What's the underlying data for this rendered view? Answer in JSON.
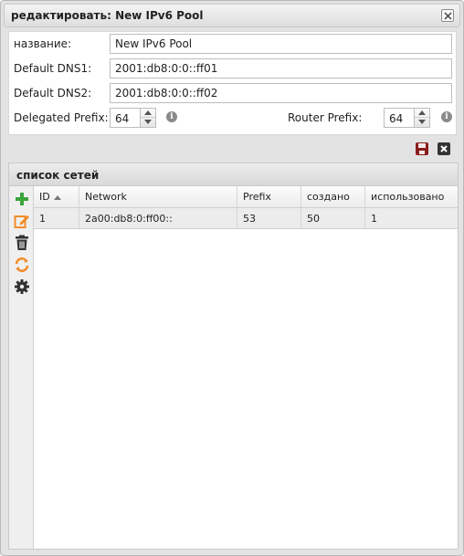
{
  "window": {
    "title": "редактировать: New IPv6 Pool"
  },
  "form": {
    "name_label": "название:",
    "name_value": "New IPv6 Pool",
    "dns1_label": "Default DNS1:",
    "dns1_value": "2001:db8:0:0::ff01",
    "dns2_label": "Default DNS2:",
    "dns2_value": "2001:db8:0:0::ff02",
    "delegated_prefix_label": "Delegated Prefix:",
    "delegated_prefix_value": "64",
    "router_prefix_label": "Router Prefix:",
    "router_prefix_value": "64",
    "info_glyph": "i"
  },
  "toolbar": {
    "save_icon": "save-icon",
    "cancel_icon": "cancel-icon"
  },
  "grid": {
    "title": "список сетей",
    "side_tools": [
      "add-icon",
      "edit-icon",
      "delete-icon",
      "refresh-icon",
      "settings-icon"
    ],
    "columns": [
      "ID",
      "Network",
      "Prefix",
      "создано",
      "использовано"
    ],
    "rows": [
      {
        "id": "1",
        "network": "2a00:db8:0:ff00::",
        "prefix": "53",
        "created": "50",
        "used": "1"
      }
    ]
  },
  "colors": {
    "add": "#3aa53a",
    "edit": "#f28c28",
    "refresh": "#f28c28",
    "save": "#8b1c1c",
    "dark": "#333333"
  }
}
